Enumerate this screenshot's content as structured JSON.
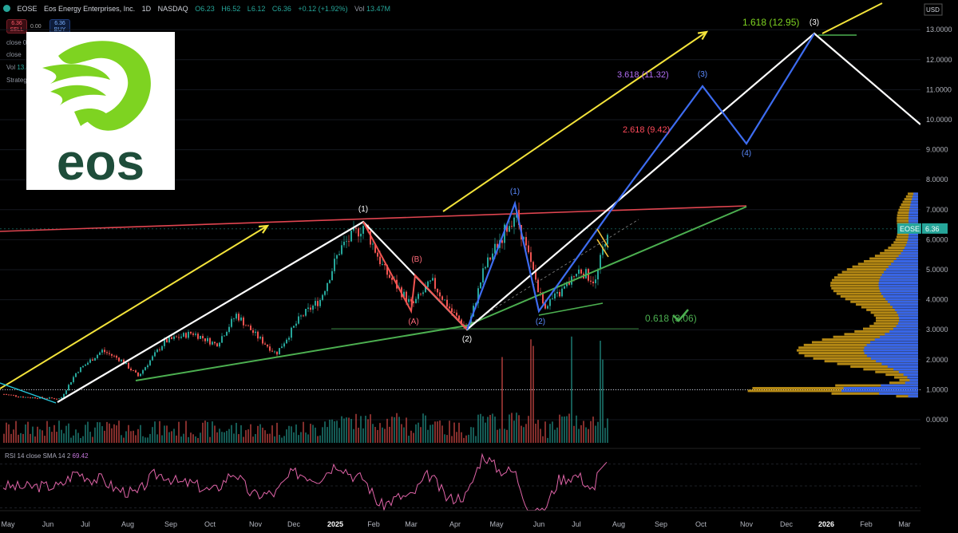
{
  "header": {
    "symbol": "EOSE",
    "name": "Eos Energy Enterprises, Inc.",
    "interval": "1D",
    "exchange": "NASDAQ",
    "ohlc": [
      {
        "label": "O",
        "value": "6.23"
      },
      {
        "label": "H",
        "value": "6.52"
      },
      {
        "label": "L",
        "value": "6.12"
      },
      {
        "label": "C",
        "value": "6.36"
      },
      {
        "label": "",
        "value": "+0.12 (+1.92%)"
      },
      {
        "label": "Vol",
        "value": "13.47M"
      }
    ]
  },
  "trade": {
    "sell_price": "6.36",
    "sell_label": "SELL",
    "spread": "0.00",
    "buy_price": "6.36",
    "buy_label": "BUY"
  },
  "indicators": [
    {
      "label": "close 0 SMA 50"
    },
    {
      "label": "close"
    },
    {
      "label": "Vol",
      "value": "13.47M"
    },
    {
      "label": "Strategy"
    }
  ],
  "logo": {
    "text": "eos",
    "colors": {
      "leaf": "#7ed321",
      "text": "#1e4d3a"
    }
  },
  "currency": "USD",
  "current_price_label": {
    "symbol": "EOSE",
    "price": "6.36"
  },
  "price_axis": [
    "13.0000",
    "12.0000",
    "11.0000",
    "10.0000",
    "9.0000",
    "8.0000",
    "7.0000",
    "6.0000",
    "5.0000",
    "4.0000",
    "3.0000",
    "2.0000",
    "1.0000",
    "0.0000"
  ],
  "time_axis": [
    "May",
    "Jun",
    "Jul",
    "Aug",
    "Sep",
    "Oct",
    "Nov",
    "Dec",
    "2025",
    "Feb",
    "Mar",
    "Apr",
    "May",
    "Jun",
    "Jul",
    "Aug",
    "Sep",
    "Oct",
    "Nov",
    "Dec",
    "2026",
    "Feb",
    "Mar"
  ],
  "rsi": {
    "title": "RSI 14 close SMA 14 2",
    "value": "69.42",
    "axis": [
      "75.00",
      "50.00",
      "25.00"
    ]
  },
  "chart_data": {
    "type": "line",
    "price_scale": {
      "ylim": [
        -0.2,
        13.5
      ]
    },
    "series": [
      {
        "name": "",
        "x": [
          "2024-05",
          "2024-06",
          "2024-07",
          "2024-08",
          "2024-09",
          "2024-10",
          "2024-11",
          "2024-12",
          "2025-01",
          "2025-02",
          "2025-03",
          "2025-04",
          "2025-05",
          "2025-06",
          "2025-07"
        ],
        "values": [
          0.85,
          0.75,
          2.3,
          1.9,
          2.6,
          2.8,
          2.2,
          4.5,
          6.4,
          4.8,
          4.2,
          3.1,
          6.9,
          3.9,
          6.36
        ]
      }
    ],
    "wave_labels": [
      {
        "text": "(1)",
        "x": "2025-01-27",
        "y": 6.7
      },
      {
        "text": "(B)",
        "x": "2025-03-01",
        "y": 4.95
      },
      {
        "text": "(A)",
        "x": "2025-03-01",
        "y": 3.65
      },
      {
        "text": "(2)",
        "x": "2025-04-08",
        "y": 2.95
      },
      {
        "text": "(1)",
        "x": "2025-05-23",
        "y": 7.2
      },
      {
        "text": "(2)",
        "x": "2025-06-18",
        "y": 3.6
      },
      {
        "text": "(3)",
        "x": "2025-10-01",
        "y": 11.2
      },
      {
        "text": "(4)",
        "x": "2025-11-01",
        "y": 9.3
      },
      {
        "text": "(3)",
        "x": "2025-12-27",
        "y": 13.0
      }
    ],
    "fib_levels": [
      {
        "text": "1.618 (12.95)",
        "value": 12.95
      },
      {
        "text": "3.618 (11.32)",
        "value": 11.32
      },
      {
        "text": "2.618 (9.42)",
        "value": 9.42
      },
      {
        "text": "0.618 (3.06)",
        "value": 3.06
      }
    ],
    "rsi_ylim": [
      20,
      90
    ],
    "rsi_ticks": [
      25,
      50,
      75
    ]
  },
  "colors": {
    "up": "#26a69a",
    "down": "#ef5350",
    "white_wave": "#ffffff",
    "blue_wave": "#3d6cf0",
    "trend_yellow": "#f3e33a",
    "resistance": "#e04550",
    "support": "#4caf50",
    "rsi": "#e064a8",
    "vp_gold": "#d4a017",
    "vp_blue": "#2962ff"
  }
}
